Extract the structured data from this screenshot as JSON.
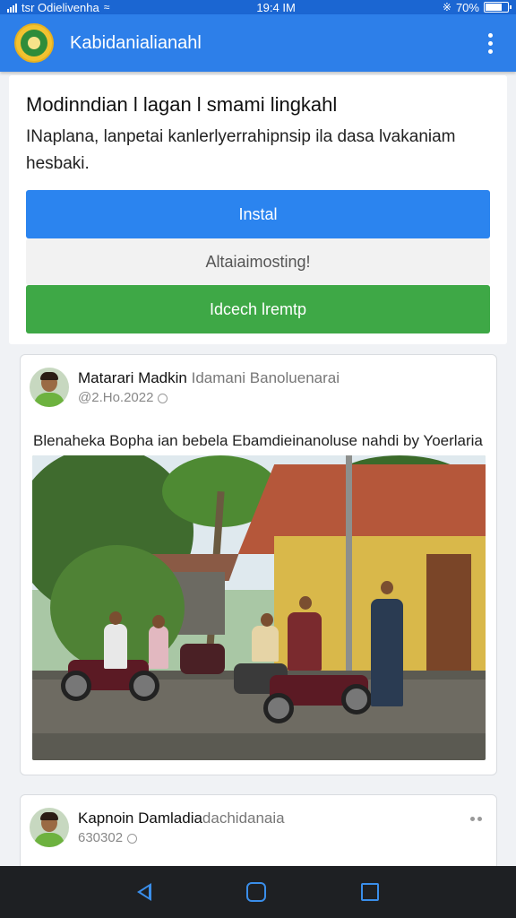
{
  "status_bar": {
    "carrier": "tsr Odielivenha",
    "time": "19:4 IM",
    "battery_text": "70%",
    "battery_level": 0.7
  },
  "app_bar": {
    "title": "Kabidanialianahl"
  },
  "install_banner": {
    "title": "Modinndian l lagan l smami lingkahl",
    "description": "INaplana, lanpetai kanlerlyerrahipnsip ila dasa lvakaniam hesbaki.",
    "install_label": "Instal",
    "alt_label": "Altaiaimosting!",
    "open_label": "Idcech lremtp"
  },
  "posts": [
    {
      "author": "Matarari Madkin",
      "author_sub": "Idamani Banoluenarai",
      "timestamp": "@2.Ho.2022",
      "text": "Blenaheka Bopha ian bebela Ebamdieinanoluse nahdi by Yoerlaria"
    },
    {
      "author": "Kapnoin Damladia",
      "author_sub": "dachidanaia",
      "timestamp": "630302"
    }
  ],
  "colors": {
    "primary": "#2d7fe9",
    "install_button": "#2b84ef",
    "green_button": "#3ea846",
    "nav_bar": "#1e2023"
  },
  "icons": [
    "signal-icon",
    "wifi-icon",
    "bluetooth-icon",
    "battery-icon",
    "app-logo",
    "overflow-menu-icon",
    "globe-icon",
    "more-icon",
    "back-icon",
    "home-icon",
    "recents-icon"
  ]
}
